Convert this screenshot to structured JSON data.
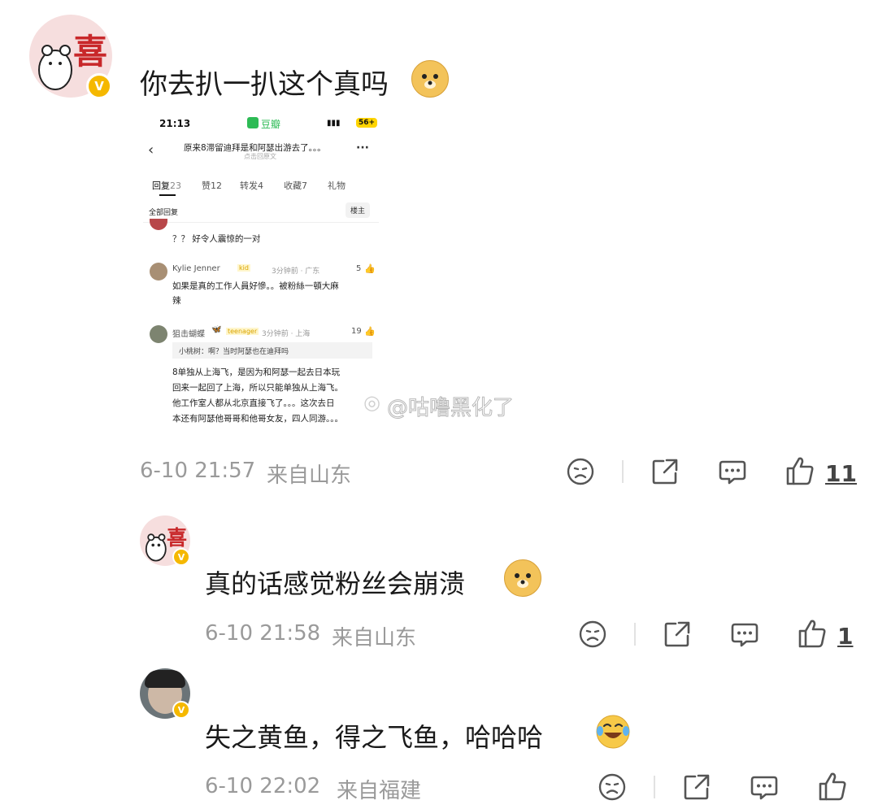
{
  "comments": [
    {
      "avatar_char": "喜",
      "text": "你去扒一扒这个真吗",
      "emoji": "doge-emoji",
      "date": "6-10 21:57",
      "location": "来自山东",
      "likes": "11"
    },
    {
      "avatar_char": "喜",
      "text": "真的话感觉粉丝会崩溃",
      "emoji": "doge-emoji",
      "date": "6-10 21:58",
      "location": "来自山东",
      "likes": "1"
    },
    {
      "text": "失之黄鱼，得之飞鱼，哈哈哈",
      "emoji": "laugh-cry-emoji",
      "date": "6-10 22:02",
      "location": "来自福建",
      "likes": ""
    }
  ],
  "verified_badge": "V",
  "screenshot": {
    "status_time": "21:13",
    "app_name": "豆瓣",
    "battery": "56+",
    "post_title": "原来8滞留迪拜是和阿瑟出游去了。。。",
    "post_subtitle": "点击回原文",
    "tabs": [
      {
        "label": "回复",
        "count": "23"
      },
      {
        "label": "赞",
        "count": "12"
      },
      {
        "label": "转发",
        "count": "4"
      },
      {
        "label": "收藏",
        "count": "7"
      },
      {
        "label": "礼物",
        "count": ""
      }
    ],
    "all_replies": "全部回复",
    "owner_tag": "楼主",
    "reply1_text": "？？ 好令人震惊的一对",
    "reply2_user": "Kylie Jenner",
    "reply2_badge": "kid",
    "reply2_meta": "3分钟前 · 广东",
    "reply2_likes": "5",
    "reply2_text_line1": "如果是真的工作人員好慘。。被粉絲一頓大麻",
    "reply2_text_line2": "辣",
    "reply3_user": "狙击蝴蝶",
    "reply3_badge": "teenager",
    "reply3_meta": "3分钟前 · 上海",
    "reply3_likes": "19",
    "reply3_quote": "小桃树：啊？当时阿瑟也在迪拜吗",
    "reply3_lines": [
      "8单独从上海飞，是因为和阿瑟一起去日本玩",
      "回来一起回了上海，所以只能单独从上海飞。",
      "他工作室人都从北京直接飞了。。。这次去日",
      "本还有阿瑟他哥哥和他哥女友，四人同游。。。"
    ]
  },
  "watermark": "@咕噜黑化了",
  "colors": {
    "meta_gray": "#9a9a9a",
    "badge_yellow": "#f5b800",
    "avatar_pink": "#f6dede",
    "douban_green": "#2dbb55"
  }
}
